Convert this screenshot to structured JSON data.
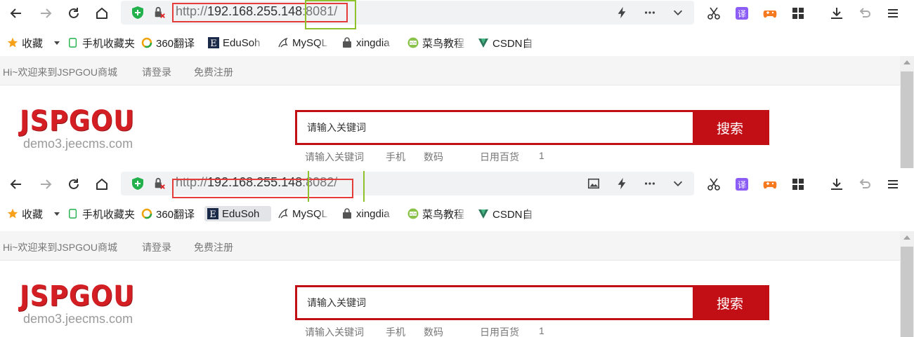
{
  "colors": {
    "url_frame": "#e53b3b",
    "port_frame": "#8ec12b",
    "brand_red": "#c20f16",
    "logo_red": "#d31f24"
  },
  "windows": [
    {
      "toolbar": {
        "icons": [
          "back-icon",
          "forward-icon",
          "reload-icon",
          "home-icon",
          "shield-icon",
          "insecure-lock-icon",
          "lightning-icon",
          "more-icon",
          "chevron-down-icon",
          "scissors-icon",
          "translate-icon",
          "game-icon",
          "apps-icon",
          "download-icon",
          "undo-icon",
          "menu-icon"
        ],
        "url_proto": "http://",
        "url_host": "192.168.255.148",
        "url_port": ":8081/"
      },
      "bookmarks": {
        "collect_label": "收藏",
        "items": [
          {
            "label": "手机收藏夹",
            "icon": "phone-icon"
          },
          {
            "label": "360翻译",
            "icon": "translate-360-icon"
          },
          {
            "label": "EduSoh",
            "icon": "edusoho-icon"
          },
          {
            "label": "MySQL",
            "icon": "mysql-icon"
          },
          {
            "label": "xingdia",
            "icon": "xingdian-icon"
          },
          {
            "label": "菜鸟教程",
            "icon": "runoob-icon"
          },
          {
            "label": "CSDN自",
            "icon": "csdn-icon"
          }
        ]
      },
      "page": {
        "welcome": "Hi~欢迎来到JSPGOU商城",
        "login": "请登录",
        "register": "免费注册",
        "logo_text": "JSPGOU",
        "logo_domain": "demo3.jeecms.com",
        "search_value": "请输入关键词",
        "search_button": "搜索",
        "hotwords": [
          "请输入关键词",
          "手机",
          "数码",
          "日用百货",
          "1"
        ]
      }
    },
    {
      "toolbar": {
        "icons": [
          "back-icon",
          "forward-icon",
          "reload-icon",
          "home-icon",
          "shield-icon",
          "insecure-lock-icon",
          "image-icon",
          "lightning-icon",
          "more-icon",
          "chevron-down-icon",
          "scissors-icon",
          "translate-icon",
          "game-icon",
          "apps-icon",
          "download-icon",
          "undo-icon",
          "menu-icon"
        ],
        "url_proto": "http://",
        "url_host": "192.168.255.148",
        "url_port": ":8082/"
      },
      "bookmarks": {
        "collect_label": "收藏",
        "items": [
          {
            "label": "手机收藏夹",
            "icon": "phone-icon"
          },
          {
            "label": "360翻译",
            "icon": "translate-360-icon"
          },
          {
            "label": "EduSoh",
            "icon": "edusoho-icon"
          },
          {
            "label": "MySQL",
            "icon": "mysql-icon"
          },
          {
            "label": "xingdia",
            "icon": "xingdian-icon"
          },
          {
            "label": "菜鸟教程",
            "icon": "runoob-icon"
          },
          {
            "label": "CSDN自",
            "icon": "csdn-icon"
          }
        ]
      },
      "page": {
        "welcome": "Hi~欢迎来到JSPGOU商城",
        "login": "请登录",
        "register": "免费注册",
        "logo_text": "JSPGOU",
        "logo_domain": "demo3.jeecms.com",
        "search_value": "请输入关键词",
        "search_button": "搜索",
        "hotwords": [
          "请输入关键词",
          "手机",
          "数码",
          "日用百货",
          "1"
        ]
      }
    }
  ]
}
